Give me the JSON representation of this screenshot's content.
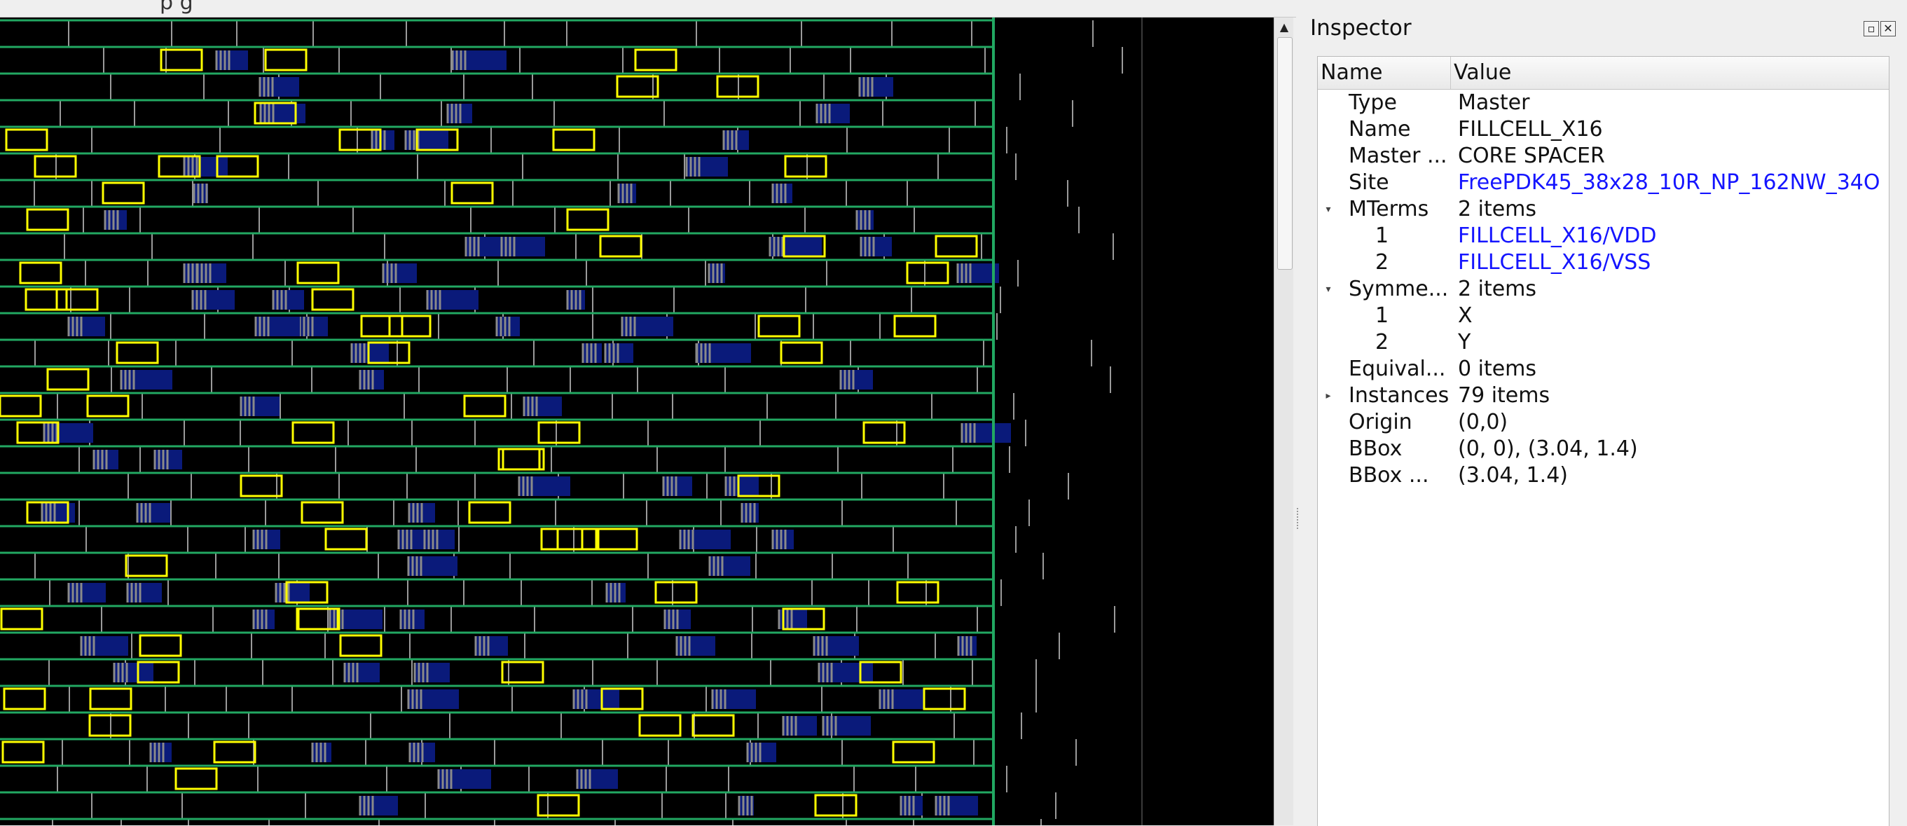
{
  "menubar": {
    "fragment": "p       g"
  },
  "canvas": {
    "colors": {
      "background": "#000000",
      "rail": "#22a862",
      "cell": "#ffff00",
      "filler": "#8a8a8a",
      "stdcell": "#0a1a7a"
    }
  },
  "inspector": {
    "title": "Inspector",
    "float_icon": "float-icon",
    "close_icon": "close-icon",
    "columns": {
      "name": "Name",
      "value": "Value"
    },
    "rows": [
      {
        "name": "Type",
        "value": "Master",
        "expander": "",
        "child": false,
        "link": false
      },
      {
        "name": "Name",
        "value": "FILLCELL_X16",
        "expander": "",
        "child": false,
        "link": false
      },
      {
        "name": "Master ...",
        "value": "CORE SPACER",
        "expander": "",
        "child": false,
        "link": false
      },
      {
        "name": "Site",
        "value": "FreePDK45_38x28_10R_NP_162NW_34O",
        "expander": "",
        "child": false,
        "link": true
      },
      {
        "name": "MTerms",
        "value": "2 items",
        "expander": "▾",
        "child": false,
        "link": false
      },
      {
        "name": "1",
        "value": "FILLCELL_X16/VDD",
        "expander": "",
        "child": true,
        "link": true
      },
      {
        "name": "2",
        "value": "FILLCELL_X16/VSS",
        "expander": "",
        "child": true,
        "link": true
      },
      {
        "name": "Symme...",
        "value": "2 items",
        "expander": "▾",
        "child": false,
        "link": false
      },
      {
        "name": "1",
        "value": "X",
        "expander": "",
        "child": true,
        "link": false
      },
      {
        "name": "2",
        "value": "Y",
        "expander": "",
        "child": true,
        "link": false
      },
      {
        "name": "Equival...",
        "value": "0 items",
        "expander": "",
        "child": false,
        "link": false
      },
      {
        "name": "Instances",
        "value": "79 items",
        "expander": "▸",
        "child": false,
        "link": false
      },
      {
        "name": "Origin",
        "value": "(0,0)",
        "expander": "",
        "child": false,
        "link": false
      },
      {
        "name": "BBox",
        "value": "(0, 0), (3.04, 1.4)",
        "expander": "",
        "child": false,
        "link": false
      },
      {
        "name": "BBox ...",
        "value": "(3.04, 1.4)",
        "expander": "",
        "child": false,
        "link": false
      }
    ]
  }
}
